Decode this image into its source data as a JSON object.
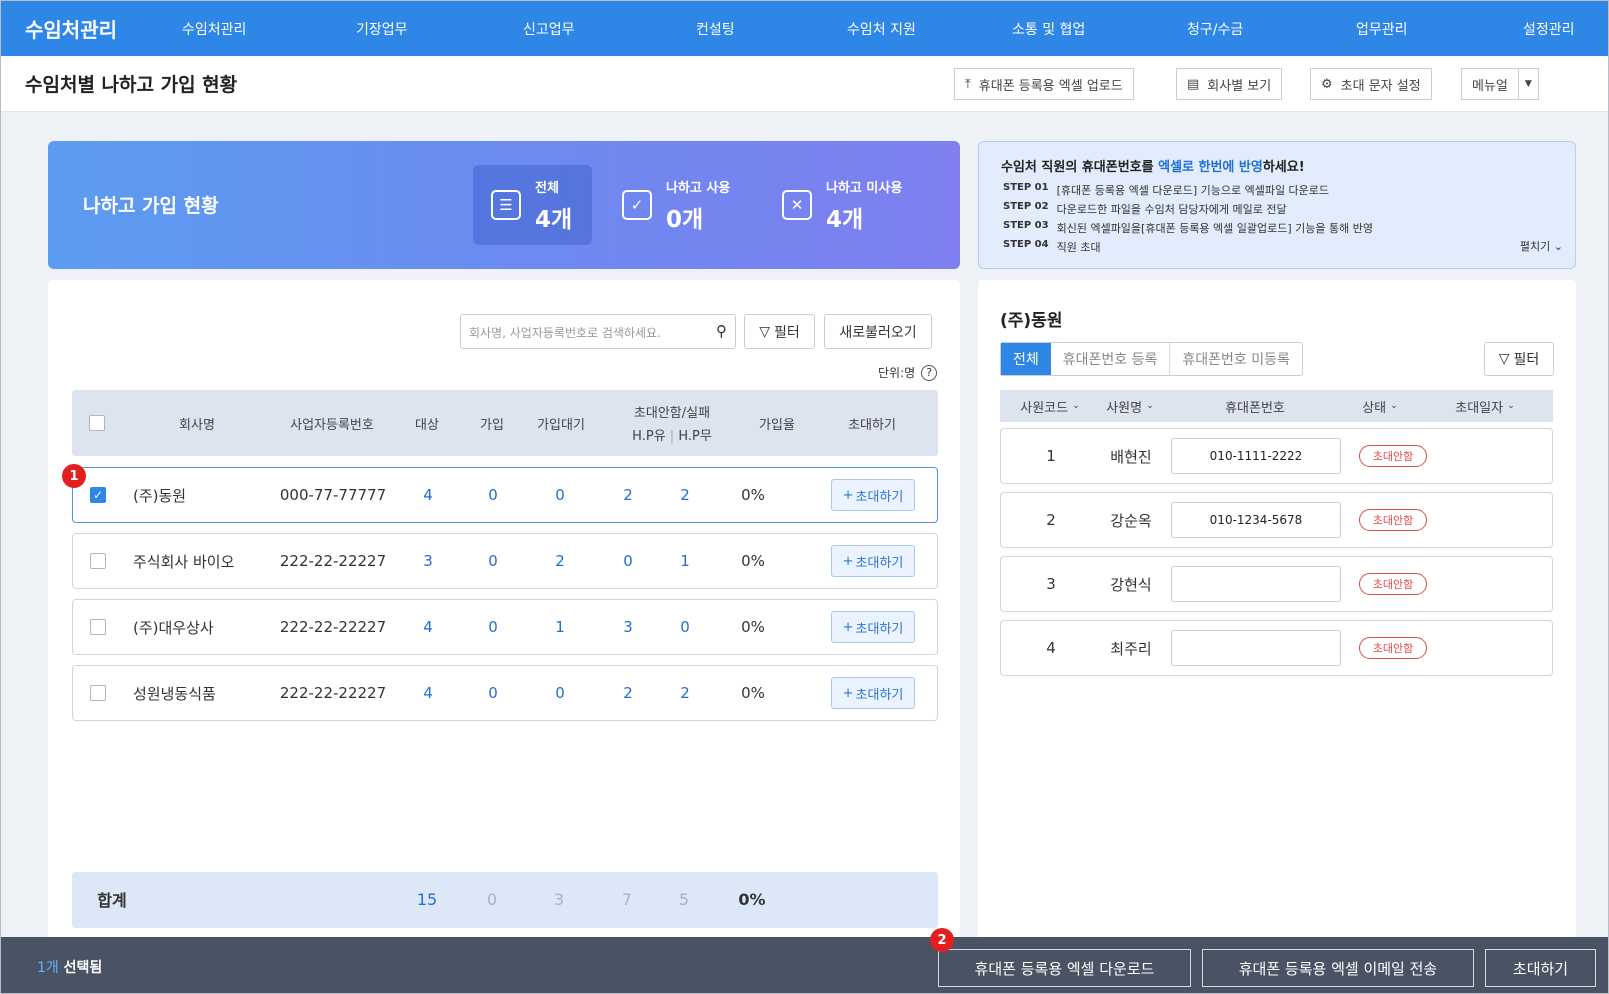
{
  "nav": {
    "brand": "수임처관리",
    "items": [
      "수임처관리",
      "기장업무",
      "신고업무",
      "컨설팅",
      "수임처 지원",
      "소통 및 협업",
      "청구/수금",
      "업무관리",
      "설정관리"
    ]
  },
  "header": {
    "title": "수임처별 나하고 가입 현황",
    "upload_label": "휴대폰 등록용 엑셀 업로드",
    "company_view_label": "회사별 보기",
    "invite_settings_label": "초대 문자 설정",
    "manual_label": "메뉴얼"
  },
  "banner": {
    "title": "나하고 가입 현황",
    "stats": [
      {
        "label": "전체",
        "value": "4개"
      },
      {
        "label": "나하고 사용",
        "value": "0개"
      },
      {
        "label": "나하고 미사용",
        "value": "4개"
      }
    ]
  },
  "info": {
    "title_pre": "수임처 직원의 휴대폰번호를 ",
    "title_hl": "엑셀로 한번에 반영",
    "title_post": "하세요!",
    "steps": [
      {
        "step": "STEP 01",
        "text": "[휴대폰 등록용 엑셀 다운로드] 기능으로 엑셀파일 다운로드"
      },
      {
        "step": "STEP 02",
        "text": "다운로드한 파일을 수임처 담당자에게 메일로 전달"
      },
      {
        "step": "STEP 03",
        "text": "회신된 엑셀파일을[휴대폰 등록용 엑셀 일괄업로드] 기능을 통해 반영"
      },
      {
        "step": "STEP 04",
        "text": "직원 초대"
      }
    ],
    "expand_label": "펼치기"
  },
  "left": {
    "search_placeholder": "회사명, 사업자등록번호로 검색하세요.",
    "filter_label": "필터",
    "refresh_label": "새로불러오기",
    "unit_label": "단위:명",
    "columns": {
      "company": "회사명",
      "bizno": "사업자등록번호",
      "target": "대상",
      "joined": "가입",
      "waiting": "가입대기",
      "uninvited": "초대안함/실패",
      "hp_yes": "H.P유",
      "hp_no": "H.P무",
      "rate": "가입율",
      "invite": "초대하기"
    },
    "rows": [
      {
        "company": "(주)동원",
        "bizno": "000-77-77777",
        "target": "4",
        "joined": "0",
        "waiting": "0",
        "hp_yes": "2",
        "hp_no": "2",
        "rate": "0%",
        "invite": "초대하기",
        "checked": true
      },
      {
        "company": "주식회사 바이오",
        "bizno": "222-22-22227",
        "target": "3",
        "joined": "0",
        "waiting": "2",
        "hp_yes": "0",
        "hp_no": "1",
        "rate": "0%",
        "invite": "초대하기",
        "checked": false
      },
      {
        "company": "(주)대우상사",
        "bizno": "222-22-22227",
        "target": "4",
        "joined": "0",
        "waiting": "1",
        "hp_yes": "3",
        "hp_no": "0",
        "rate": "0%",
        "invite": "초대하기",
        "checked": false
      },
      {
        "company": "성원냉동식품",
        "bizno": "222-22-22227",
        "target": "4",
        "joined": "0",
        "waiting": "0",
        "hp_yes": "2",
        "hp_no": "2",
        "rate": "0%",
        "invite": "초대하기",
        "checked": false
      }
    ],
    "total": {
      "label": "합계",
      "target": "15",
      "joined": "0",
      "waiting": "3",
      "hp_yes": "7",
      "hp_no": "5",
      "rate": "0%"
    }
  },
  "right": {
    "title": "(주)동원",
    "tabs": [
      "전체",
      "휴대폰번호 등록",
      "휴대폰번호 미등록"
    ],
    "filter_label": "필터",
    "columns": [
      "사원코드",
      "사원명",
      "휴대폰번호",
      "상태",
      "초대일자"
    ],
    "rows": [
      {
        "code": "1",
        "name": "배현진",
        "phone": "010-1111-2222",
        "status": "초대안함"
      },
      {
        "code": "2",
        "name": "강순옥",
        "phone": "010-1234-5678",
        "status": "초대안함"
      },
      {
        "code": "3",
        "name": "강현식",
        "phone": "",
        "status": "초대안함"
      },
      {
        "code": "4",
        "name": "최주리",
        "phone": "",
        "status": "초대안함"
      }
    ]
  },
  "bottom": {
    "count": "1개",
    "selected_label": " 선택됨",
    "download_label": "휴대폰 등록용 엑셀 다운로드",
    "email_label": "휴대폰 등록용 엑셀 이메일 전송",
    "invite_label": "초대하기"
  },
  "badges": [
    "1",
    "2"
  ]
}
